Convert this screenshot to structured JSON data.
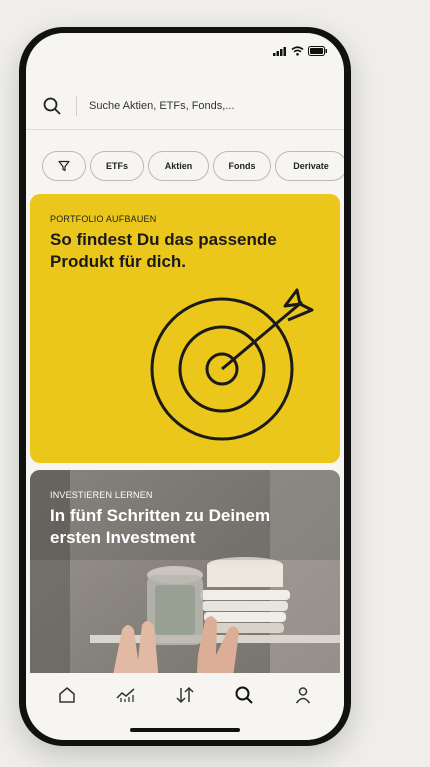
{
  "search": {
    "placeholder": "Suche Aktien, ETFs, Fonds,..."
  },
  "filters": [
    {
      "label": "ETFs"
    },
    {
      "label": "Aktien"
    },
    {
      "label": "Fonds"
    },
    {
      "label": "Derivate"
    }
  ],
  "cards": [
    {
      "eyebrow": "PORTFOLIO AUFBAUEN",
      "title": "So findest Du das passende Produkt für dich.",
      "icon": "target-icon",
      "color": "#ECC71B"
    },
    {
      "eyebrow": "INVESTIEREN LERNEN",
      "title": "In fünf Schritten zu Deinem ersten Investment"
    }
  ],
  "tabbar": {
    "items": [
      {
        "icon": "home-icon"
      },
      {
        "icon": "chart-icon"
      },
      {
        "icon": "transfer-arrows-icon"
      },
      {
        "icon": "search-icon"
      },
      {
        "icon": "profile-icon"
      }
    ]
  },
  "colors": {
    "background": "#EFEEEB",
    "screen": "#F6F5F2",
    "accent": "#ECC71B"
  }
}
